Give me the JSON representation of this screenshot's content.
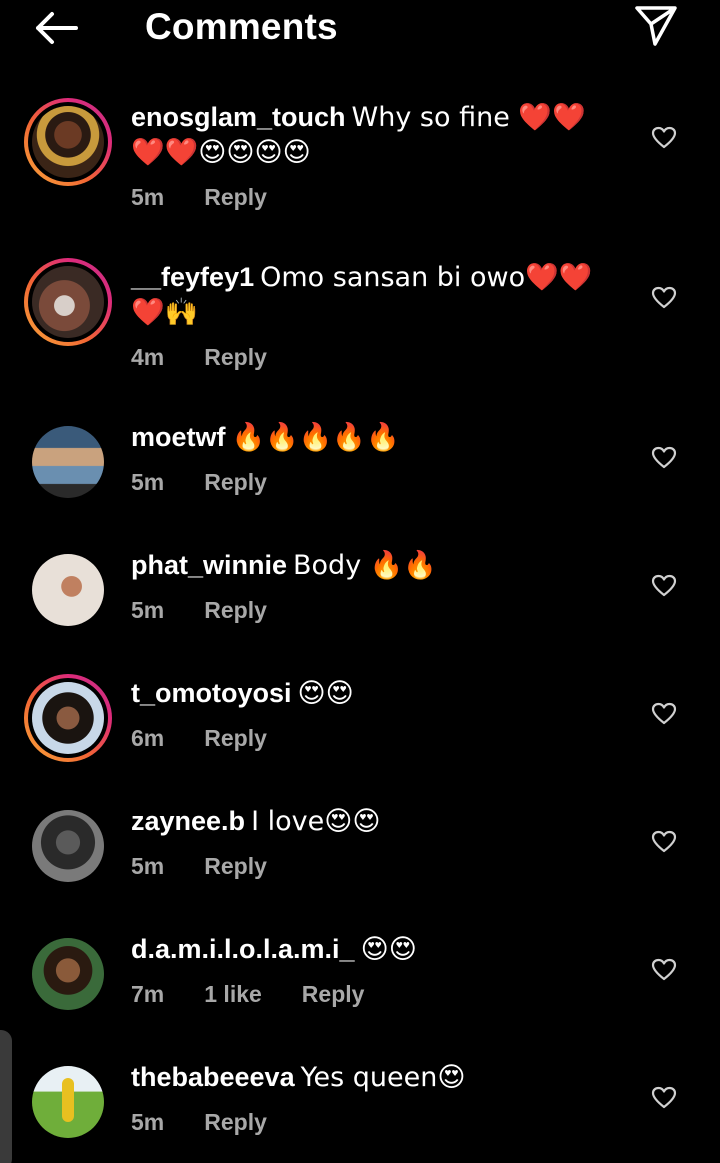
{
  "header": {
    "title": "Comments",
    "back_icon": "arrow-left-icon",
    "share_icon": "paper-plane-icon"
  },
  "colors": {
    "background": "#000000",
    "text": "#ffffff",
    "meta_text": "#a8a8a8",
    "story_ring_start": "#f9a93a",
    "story_ring_end": "#c13584"
  },
  "comments": [
    {
      "username": "enosglam_touch",
      "text": "Why so fine ❤️❤️❤️❤️😍😍😍😍",
      "time": "5m",
      "likes": "",
      "reply": "Reply",
      "story_ring": true
    },
    {
      "username": "__feyfey1",
      "text": "Omo sansan bi owo❤️❤️❤️🙌",
      "time": "4m",
      "likes": "",
      "reply": "Reply",
      "story_ring": true
    },
    {
      "username": "moetwf",
      "text": "🔥🔥🔥🔥🔥",
      "time": "5m",
      "likes": "",
      "reply": "Reply",
      "story_ring": false
    },
    {
      "username": "phat_winnie",
      "text": "Body 🔥🔥",
      "time": "5m",
      "likes": "",
      "reply": "Reply",
      "story_ring": false
    },
    {
      "username": "t_omotoyosi",
      "text": "😍😍",
      "time": "6m",
      "likes": "",
      "reply": "Reply",
      "story_ring": true
    },
    {
      "username": "zaynee.b",
      "text": "I love😍😍",
      "time": "5m",
      "likes": "",
      "reply": "Reply",
      "story_ring": false
    },
    {
      "username": "d.a.m.i.l.o.l.a.m.i_",
      "text": "😍😍",
      "time": "7m",
      "likes": "1 like",
      "reply": "Reply",
      "story_ring": false
    },
    {
      "username": "thebabeeeva",
      "text": "Yes queen😍",
      "time": "5m",
      "likes": "",
      "reply": "Reply",
      "story_ring": false
    }
  ]
}
